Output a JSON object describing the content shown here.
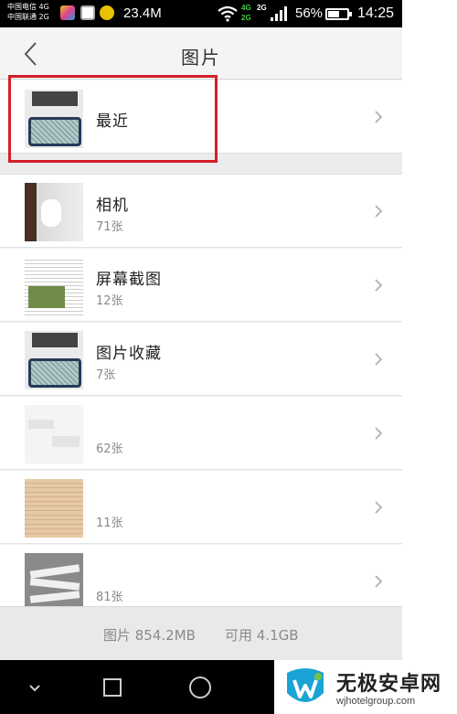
{
  "status_bar": {
    "carrier_1": "中国电信 4G",
    "carrier_2": "中国联通 2G",
    "mid_time": "23.4M",
    "net_top_left": "4G",
    "net_bottom_left": "2G",
    "net_top_right": "2G",
    "battery_percent": "56%",
    "battery_level": 0.56,
    "time": "14:25"
  },
  "header": {
    "title": "图片"
  },
  "albums": [
    {
      "name": "最近",
      "count": ""
    },
    {
      "name": "相机",
      "count": "71张"
    },
    {
      "name": "屏幕截图",
      "count": "12张"
    },
    {
      "name": "图片收藏",
      "count": "7张"
    },
    {
      "name": "",
      "count": "62张"
    },
    {
      "name": "",
      "count": "11张"
    },
    {
      "name": "",
      "count": "81张"
    }
  ],
  "footer": {
    "pictures": "图片 854.2MB",
    "available": "可用 4.1GB"
  },
  "watermark": {
    "title": "无极安卓网",
    "url": "wjhotelgroup.com"
  },
  "colors": {
    "highlight": "#d21f2a",
    "header_bg": "#f4f4f4",
    "footer_text": "#8a8a8a"
  }
}
